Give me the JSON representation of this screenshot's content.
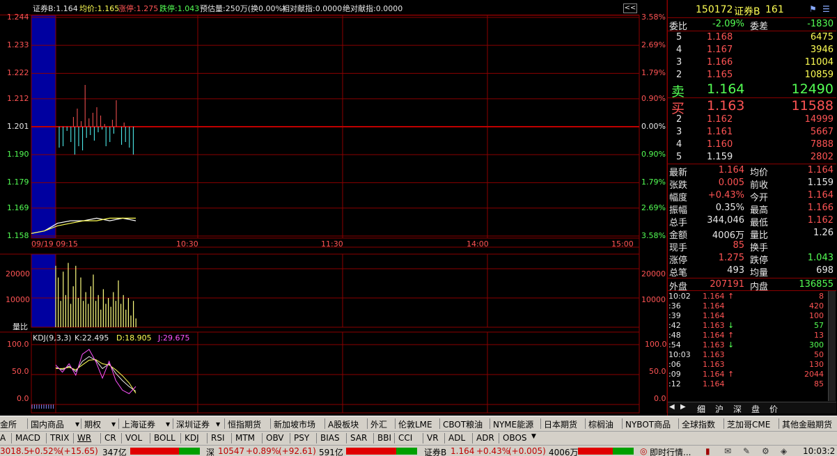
{
  "header": {
    "name_price": "证券B:1.164",
    "avg": "均价:1.165",
    "limit_up": "涨停:1.275",
    "limit_down": "跌停:1.043",
    "estimate": "预估量:250万(换0.00%)",
    "rel_contrib": "相对献指:0.0000",
    "abs_contrib": "绝对献指:0.0000",
    "collapse_btn": "<<"
  },
  "price_axis": {
    "left": [
      "1.244",
      "1.233",
      "1.222",
      "1.212",
      "1.201",
      "1.190",
      "1.179",
      "1.169",
      "1.158"
    ],
    "right": [
      "3.58%",
      "2.69%",
      "1.79%",
      "0.90%",
      "0.00%",
      "0.90%",
      "1.79%",
      "2.69%",
      "3.58%"
    ]
  },
  "time_axis": {
    "date_start": "09/19 09:15",
    "t1": "10:30",
    "t2": "11:30",
    "t3": "14:00",
    "t4": "15:00"
  },
  "volume_axis": {
    "left": [
      "20000",
      "10000"
    ],
    "right": [
      "20000",
      "10000"
    ],
    "label": "量比"
  },
  "kdj": {
    "title": "KDJ(9,3,3)",
    "k": "K:22.495",
    "d": "D:18.905",
    "j": "J:29.675",
    "axis": [
      "100.0",
      "50.0",
      "0.0"
    ]
  },
  "chart_data": [
    {
      "type": "line",
      "title": "",
      "series": [
        {
          "name": "",
          "x": [
            "09:30",
            "09:33",
            "09:36",
            "09:40",
            "09:45",
            "09:50",
            "09:55",
            "10:00",
            "10:03"
          ],
          "y": [
            1.159,
            1.16,
            1.163,
            1.164,
            1.164,
            1.165,
            1.164,
            1.165,
            1.164
          ]
        },
        {
          "name": "均价",
          "x": [
            "09:30",
            "09:33",
            "09:36",
            "09:40",
            "09:45",
            "09:50",
            "09:55",
            "10:00",
            "10:03"
          ],
          "y": [
            1.159,
            1.16,
            1.162,
            1.163,
            1.164,
            1.164,
            1.165,
            1.165,
            1.165
          ]
        }
      ],
      "ylim": [
        1.158,
        1.244
      ]
    },
    {
      "type": "bar",
      "title": "",
      "ylabel": "量比",
      "values": [
        21000,
        17000,
        9000,
        19000,
        11000,
        22000,
        8000,
        14000,
        21000,
        10000,
        17000,
        9000,
        12000,
        8000,
        14000,
        18000,
        9000,
        11000,
        6000,
        13000,
        8000,
        10000,
        7000,
        12000,
        9000,
        16000,
        8000,
        11000,
        6000,
        10000,
        4000,
        9000,
        3000
      ],
      "ylim": [
        0,
        25000
      ]
    },
    {
      "type": "line",
      "title": "KDJ(9,3,3)",
      "series": [
        {
          "name": "K",
          "y": [
            62,
            58,
            64,
            55,
            72,
            80,
            74,
            60,
            68,
            52,
            40,
            30,
            22
          ]
        },
        {
          "name": "D",
          "y": [
            60,
            60,
            62,
            58,
            66,
            74,
            75,
            68,
            66,
            58,
            48,
            36,
            19
          ]
        },
        {
          "name": "J",
          "y": [
            66,
            54,
            68,
            49,
            84,
            92,
            72,
            44,
            72,
            40,
            24,
            18,
            30
          ]
        }
      ],
      "ylim": [
        0,
        100
      ]
    }
  ],
  "quote": {
    "code": "150172",
    "name": "证券B",
    "num": "161",
    "wei_bi_label": "委比",
    "wei_bi": "-2.09%",
    "wei_cha_label": "委差",
    "wei_cha": "-1830",
    "sell": [
      {
        "lvl": "5",
        "price": "1.168",
        "vol": "6475"
      },
      {
        "lvl": "4",
        "price": "1.167",
        "vol": "3946"
      },
      {
        "lvl": "3",
        "price": "1.166",
        "vol": "11004"
      },
      {
        "lvl": "2",
        "price": "1.165",
        "vol": "10859"
      }
    ],
    "sell1": {
      "lbl": "卖",
      "price": "1.164",
      "vol": "12490"
    },
    "buy1": {
      "lbl": "买",
      "price": "1.163",
      "vol": "11588"
    },
    "buy": [
      {
        "lvl": "2",
        "price": "1.162",
        "vol": "14999"
      },
      {
        "lvl": "3",
        "price": "1.161",
        "vol": "5667"
      },
      {
        "lvl": "4",
        "price": "1.160",
        "vol": "7888"
      },
      {
        "lvl": "5",
        "price": "1.159",
        "vol": "2802"
      }
    ],
    "stats": [
      {
        "l1": "最新",
        "v1": "1.164",
        "l2": "均价",
        "v2": "1.164"
      },
      {
        "l1": "张跌",
        "v1": "0.005",
        "l2": "前收",
        "v2": "1.159"
      },
      {
        "l1": "幅度",
        "v1": "+0.43%",
        "l2": "今开",
        "v2": "1.164"
      },
      {
        "l1": "振幅",
        "v1": "0.35%",
        "l2": "最高",
        "v2": "1.166"
      },
      {
        "l1": "总手",
        "v1": "344,046",
        "l2": "最低",
        "v2": "1.162"
      },
      {
        "l1": "金额",
        "v1": "4006万",
        "l2": "量比",
        "v2": "1.26"
      },
      {
        "l1": "现手",
        "v1": "85",
        "l2": "换手",
        "v2": ""
      },
      {
        "l1": "涨停",
        "v1": "1.275",
        "l2": "跌停",
        "v2": "1.043"
      },
      {
        "l1": "总笔",
        "v1": "493",
        "l2": "均量",
        "v2": "698"
      }
    ],
    "outer_label": "外盘",
    "outer": "207191",
    "inner_label": "内盘",
    "inner": "136855"
  },
  "ticks": [
    {
      "t": "10:02",
      "p": "1.164",
      "a": "↑",
      "v": "8"
    },
    {
      "t": ":36",
      "p": "1.164",
      "a": "",
      "v": "420"
    },
    {
      "t": ":39",
      "p": "1.164",
      "a": "",
      "v": "100"
    },
    {
      "t": ":42",
      "p": "1.163",
      "a": "↓",
      "v": "57"
    },
    {
      "t": ":48",
      "p": "1.164",
      "a": "↑",
      "v": "13"
    },
    {
      "t": ":54",
      "p": "1.163",
      "a": "↓",
      "v": "300"
    },
    {
      "t": "10:03",
      "p": "1.163",
      "a": "",
      "v": "50"
    },
    {
      "t": ":06",
      "p": "1.163",
      "a": "",
      "v": "130"
    },
    {
      "t": ":09",
      "p": "1.164",
      "a": "↑",
      "v": "2044"
    },
    {
      "t": ":12",
      "p": "1.164",
      "a": "",
      "v": "85"
    }
  ],
  "tick_tabs": [
    "细",
    "沪",
    "深",
    "盘",
    "价"
  ],
  "menu": [
    "金所",
    "国内商品",
    "期权",
    "上海证券",
    "深圳证券",
    "恒指期货",
    "新加坡市场",
    "A股板块",
    "外汇",
    "伦敦LME",
    "CBOT粮油",
    "NYME能源",
    "日本期货",
    "棕榈油",
    "NYBOT商品",
    "全球指数",
    "芝加哥CME",
    "其他金融期货"
  ],
  "indicators": [
    "A",
    "MACD",
    "TRIX",
    "WR",
    "CR",
    "VOL",
    "BOLL",
    "KDJ",
    "RSI",
    "MTM",
    "OBV",
    "PSY",
    "BIAS",
    "SAR",
    "BBI",
    "CCI",
    "VR",
    "ADL",
    "ADR",
    "OBOS"
  ],
  "status": {
    "sh": "3018.5",
    "sh_chg": "+0.52%",
    "sh_pts": "(+15.65)",
    "sh_amt": "347亿",
    "sz_label": "深",
    "sz": "10547",
    "sz_chg": "+0.89%",
    "sz_pts": "(+92.61)",
    "sz_amt": "591亿",
    "stk": "证券B",
    "stk_price": "1.164",
    "stk_chg": "+0.43%",
    "stk_pts": "(+0.005)",
    "stk_amt": "4006万",
    "realtime": "即时行情...",
    "clock": "10:03:2"
  },
  "colors": {
    "up": "#ff5454",
    "down": "#54ff54",
    "grid": "#8b0000",
    "price": "#ffffff",
    "avg": "#ffff54"
  }
}
